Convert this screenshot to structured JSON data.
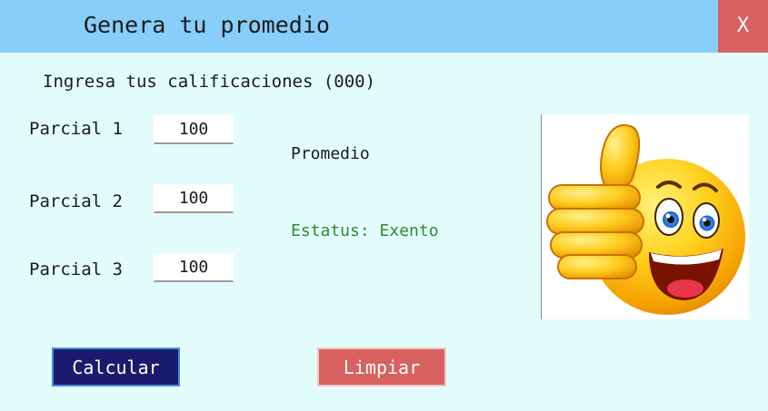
{
  "window": {
    "title": "Genera tu promedio",
    "close_label": "X"
  },
  "form": {
    "instructions": "Ingresa tus calificaciones (000)",
    "parcial_1": {
      "label": "Parcial 1",
      "value": "100"
    },
    "parcial_2": {
      "label": "Parcial 2",
      "value": "100"
    },
    "parcial_3": {
      "label": "Parcial 3",
      "value": "100"
    }
  },
  "result": {
    "promedio_label": "Promedio",
    "status_text": "Estatus: Exento"
  },
  "buttons": {
    "calcular": "Calcular",
    "limpiar": "Limpiar"
  },
  "image": {
    "icon": "thumbs-up-smiley-emoji"
  },
  "colors": {
    "titlebar": "#87cefa",
    "background": "#e3fdfd",
    "close": "#d9615f",
    "calcular": "#1a1a6e",
    "limpiar": "#d9615f",
    "status": "#2e8b2e"
  }
}
